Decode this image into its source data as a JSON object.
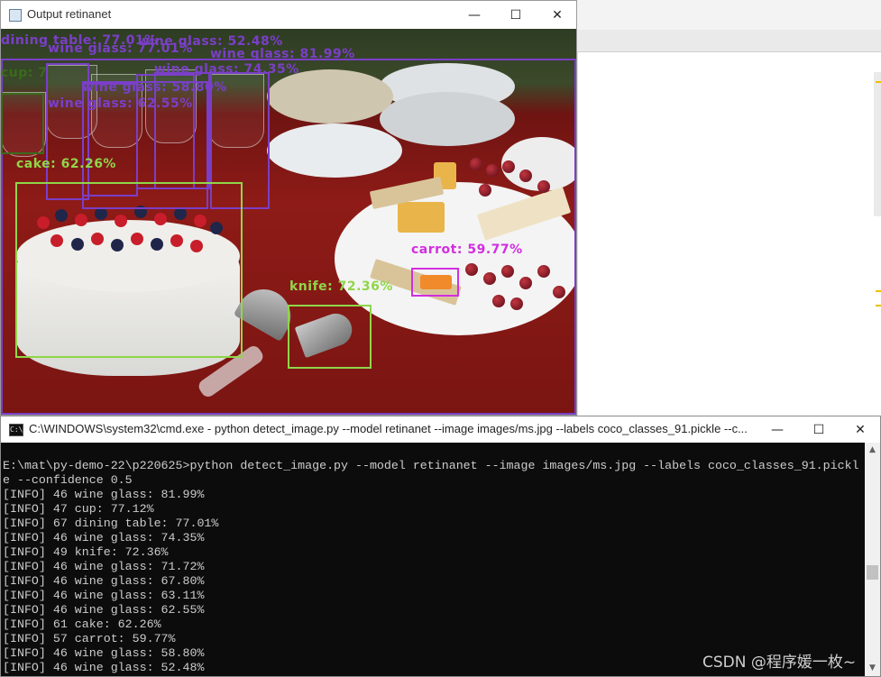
{
  "output_window": {
    "title": "Output retinanet",
    "minimize": "—",
    "maximize": "☐",
    "close": "✕"
  },
  "detections": [
    {
      "label": "dining table: 77.01%",
      "color": "#7a3fc7"
    },
    {
      "label": "cup: 7",
      "color": "#3a6b1c"
    },
    {
      "label": "wine glass: 77.01%",
      "color": "#7a3fc7"
    },
    {
      "label": "wine glass: 52.48%",
      "color": "#7a3fc7"
    },
    {
      "label": "wine glass: 81.99%",
      "color": "#7a3fc7"
    },
    {
      "label": "wine glass: 74.35%",
      "color": "#7a3fc7"
    },
    {
      "label": "wine glass: 58.80%",
      "color": "#7a3fc7"
    },
    {
      "label": "wine glass: 62.55%",
      "color": "#7a3fc7"
    },
    {
      "label": "cake: 62.26%",
      "color": "#8fd64a"
    },
    {
      "label": "carrot: 59.77%",
      "color": "#d22ee0"
    },
    {
      "label": "knife: 72.36%",
      "color": "#8fd64a"
    }
  ],
  "console_window": {
    "title": "C:\\WINDOWS\\system32\\cmd.exe - python  detect_image.py --model retinanet --image images/ms.jpg --labels coco_classes_91.pickle --c...",
    "minimize": "—",
    "maximize": "☐",
    "close": "✕",
    "lines": [
      "E:\\mat\\py-demo-22\\p220625>python detect_image.py --model retinanet --image images/ms.jpg --labels coco_classes_91.pickl",
      "e --confidence 0.5",
      "[INFO] 46 wine glass: 81.99%",
      "[INFO] 47 cup: 77.12%",
      "[INFO] 67 dining table: 77.01%",
      "[INFO] 46 wine glass: 74.35%",
      "[INFO] 49 knife: 72.36%",
      "[INFO] 46 wine glass: 71.72%",
      "[INFO] 46 wine glass: 67.80%",
      "[INFO] 46 wine glass: 63.11%",
      "[INFO] 46 wine glass: 62.55%",
      "[INFO] 61 cake: 62.26%",
      "[INFO] 57 carrot: 59.77%",
      "[INFO] 46 wine glass: 58.80%",
      "[INFO] 46 wine glass: 52.48%"
    ]
  },
  "watermark": "CSDN @程序媛一枚~"
}
